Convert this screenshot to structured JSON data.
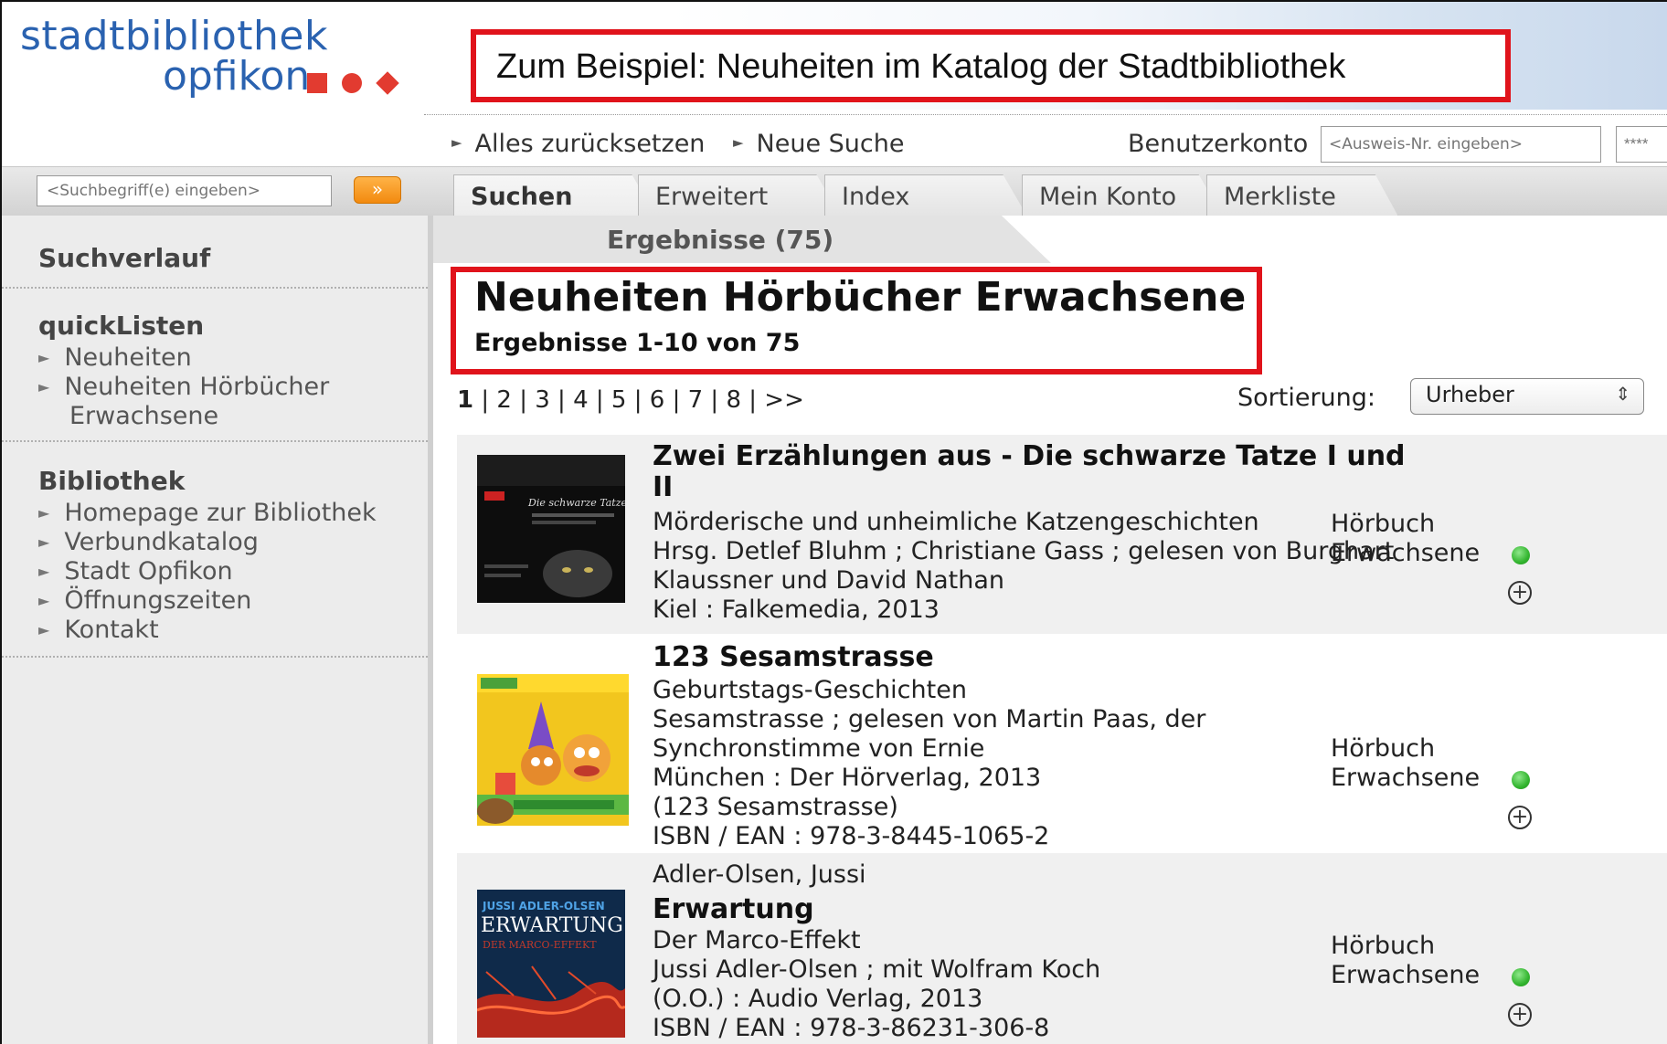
{
  "logo": {
    "line1": "stadtbibliothek",
    "line2": "opfikon"
  },
  "banner": {
    "text": "Zum Beispiel: Neuheiten im Katalog der Stadtbibliothek"
  },
  "toplinks": {
    "reset": "Alles zurücksetzen",
    "new_search": "Neue Suche",
    "account_label": "Benutzerkonto",
    "account_placeholder": "<Ausweis-Nr. eingeben>",
    "password_mask": "****"
  },
  "search": {
    "placeholder": "<Suchbegriff(e) eingeben>",
    "button": "»"
  },
  "tabs": [
    {
      "label": "Suchen"
    },
    {
      "label": "Erweitert"
    },
    {
      "label": "Index"
    },
    {
      "label": "Mein Konto"
    },
    {
      "label": "Merkliste"
    }
  ],
  "sidebar": {
    "history_heading": "Suchverlauf",
    "quicklists_heading": "quickListen",
    "quicklists": [
      "Neuheiten",
      "Neuheiten Hörbücher",
      "Erwachsene"
    ],
    "library_heading": "Bibliothek",
    "library_links": [
      "Homepage zur Bibliothek",
      "Verbundkatalog",
      "Stadt Opfikon",
      "Öffnungszeiten",
      "Kontakt"
    ]
  },
  "results": {
    "tab_label": "Ergebnisse (75)",
    "title": "Neuheiten Hörbücher Erwachsene",
    "count": "Ergebnisse 1-10 von 75",
    "pager": [
      "1",
      "2",
      "3",
      "4",
      "5",
      "6",
      "7",
      "8",
      ">>"
    ],
    "sort_label": "Sortierung:",
    "sort_value": "Urheber"
  },
  "entries": [
    {
      "title1": "Zwei Erzählungen aus - Die schwarze Tatze I und",
      "title2": "II",
      "subtitle": "Mörderische und unheimliche Katzengeschichten",
      "credits1": "Hrsg. Detlef Bluhm ; Christiane Gass ; gelesen von Burghart",
      "credits2": "Klaussner und David Nathan",
      "publisher": "Kiel : Falkemedia, 2013",
      "type1": "Hörbuch",
      "type2": "Erwachsene"
    },
    {
      "title1": "123 Sesamstrasse",
      "subtitle": "Geburtstags-Geschichten",
      "credits1": "Sesamstrasse ; gelesen von Martin Paas, der",
      "credits2": "Synchronstimme von Ernie",
      "publisher": "München : Der Hörverlag, 2013",
      "series": "(123 Sesamstrasse)",
      "isbn": "ISBN / EAN : 978-3-8445-1065-2",
      "type1": "Hörbuch",
      "type2": "Erwachsene"
    },
    {
      "author": "Adler-Olsen, Jussi",
      "title1": "Erwartung",
      "subtitle": "Der Marco-Effekt",
      "credits1": "Jussi Adler-Olsen ; mit Wolfram Koch",
      "publisher": "(O.O.) : Audio Verlag, 2013",
      "isbn": "ISBN / EAN : 978-3-86231-306-8",
      "type1": "Hörbuch",
      "type2": "Erwachsene",
      "cover_text1": "JUSSI ADLER-OLSEN",
      "cover_text2": "ERWARTUNG",
      "cover_text3": "DER MARCO-EFFEKT"
    }
  ],
  "colors": {
    "accent_red": "#e0131b",
    "logo_blue": "#2a62b0",
    "available_green": "#33b52f",
    "search_orange": "#f28a0f"
  },
  "icons": {
    "available": "green-dot-icon",
    "add": "plus-circle-icon",
    "submit": "double-chevron-icon"
  }
}
